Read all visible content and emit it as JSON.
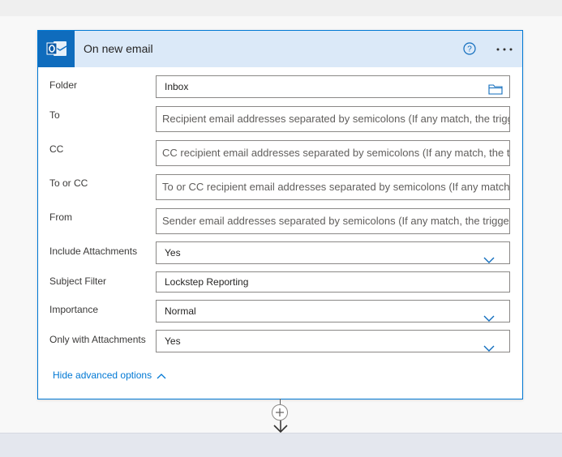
{
  "trigger": {
    "title": "On new email",
    "icon": "outlook-icon",
    "accent": "#0078d4",
    "fields": [
      {
        "label": "Folder",
        "value": "Inbox",
        "kind": "folder-picker"
      },
      {
        "label": "To",
        "placeholder": "Recipient email addresses separated by semicolons (If any match, the trigger will run)",
        "kind": "text"
      },
      {
        "label": "CC",
        "placeholder": "CC recipient email addresses separated by semicolons (If any match, the trigger will run)",
        "kind": "text"
      },
      {
        "label": "To or CC",
        "placeholder": "To or CC recipient email addresses separated by semicolons (If any match, the trigger will run)",
        "kind": "text"
      },
      {
        "label": "From",
        "placeholder": "Sender email addresses separated by semicolons (If any match, the trigger will run)",
        "kind": "text"
      },
      {
        "label": "Include Attachments",
        "value": "Yes",
        "kind": "dropdown"
      },
      {
        "label": "Subject Filter",
        "value": "Lockstep Reporting",
        "kind": "text-value"
      },
      {
        "label": "Importance",
        "value": "Normal",
        "kind": "dropdown"
      },
      {
        "label": "Only with Attachments",
        "value": "Yes",
        "kind": "dropdown"
      }
    ],
    "advanced_toggle": "Hide advanced options"
  }
}
